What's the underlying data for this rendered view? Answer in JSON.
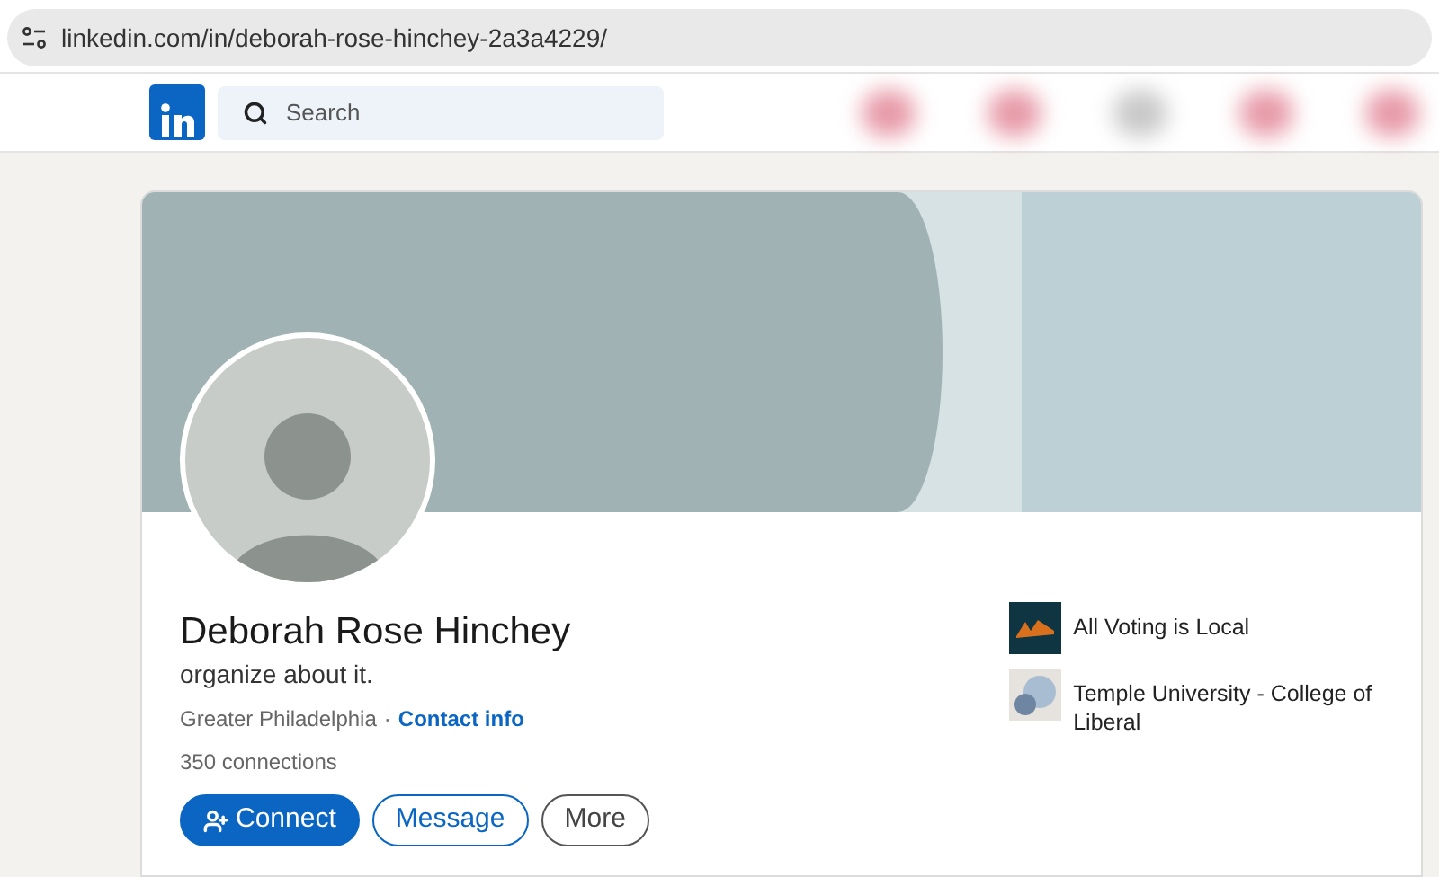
{
  "address_bar": {
    "url": "linkedin.com/in/deborah-rose-hinchey-2a3a4229/"
  },
  "nav": {
    "search": {
      "placeholder": "Search"
    }
  },
  "profile": {
    "name": "Deborah Rose Hinchey",
    "headline": "organize about it.",
    "location": "Greater Philadelphia",
    "separator": "·",
    "contact_link": "Contact info",
    "connections": "350 connections",
    "buttons": [
      {
        "label": "Connect",
        "kind": "primary"
      },
      {
        "label": "Message",
        "kind": "outline"
      },
      {
        "label": "More",
        "kind": "neutral"
      }
    ],
    "affiliations": [
      {
        "label": "All Voting is Local",
        "kind": "organization"
      },
      {
        "label": "Temple University - College of Liberal",
        "kind": "school"
      }
    ]
  }
}
